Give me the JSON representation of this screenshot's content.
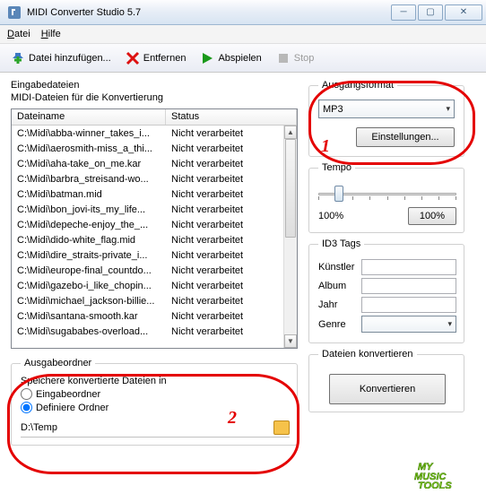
{
  "window": {
    "title": "MIDI Converter Studio 5.7"
  },
  "menu": {
    "file": "Datei",
    "help": "Hilfe"
  },
  "toolbar": {
    "add": "Datei hinzufügen...",
    "remove": "Entfernen",
    "play": "Abspielen",
    "stop": "Stop"
  },
  "input": {
    "heading": "Eingabedateien",
    "sub": "MIDI-Dateien für die Konvertierung",
    "col_name": "Dateiname",
    "col_status": "Status",
    "status_default": "Nicht verarbeitet",
    "files": [
      "C:\\Midi\\abba-winner_takes_i...",
      "C:\\Midi\\aerosmith-miss_a_thi...",
      "C:\\Midi\\aha-take_on_me.kar",
      "C:\\Midi\\barbra_streisand-wo...",
      "C:\\Midi\\batman.mid",
      "C:\\Midi\\bon_jovi-its_my_life...",
      "C:\\Midi\\depeche-enjoy_the_...",
      "C:\\Midi\\dido-white_flag.mid",
      "C:\\Midi\\dire_straits-private_i...",
      "C:\\Midi\\europe-final_countdo...",
      "C:\\Midi\\gazebo-i_like_chopin...",
      "C:\\Midi\\michael_jackson-billie...",
      "C:\\Midi\\santana-smooth.kar",
      "C:\\Midi\\sugababes-overload..."
    ]
  },
  "output_folder": {
    "legend": "Ausgabeordner",
    "store_in": "Speichere konvertierte Dateien in",
    "opt_input": "Eingabeordner",
    "opt_define": "Definiere Ordner",
    "path": "D:\\Temp"
  },
  "format": {
    "legend": "Ausgangsformat",
    "selected": "MP3",
    "settings_btn": "Einstellungen..."
  },
  "tempo": {
    "legend": "Tempo",
    "left_label": "100%",
    "reset_btn": "100%"
  },
  "id3": {
    "legend": "ID3 Tags",
    "artist": "Künstler",
    "album": "Album",
    "year": "Jahr",
    "genre": "Genre"
  },
  "convert": {
    "legend": "Dateien konvertieren",
    "button": "Konvertieren"
  },
  "annotations": {
    "one": "1",
    "two": "2"
  }
}
